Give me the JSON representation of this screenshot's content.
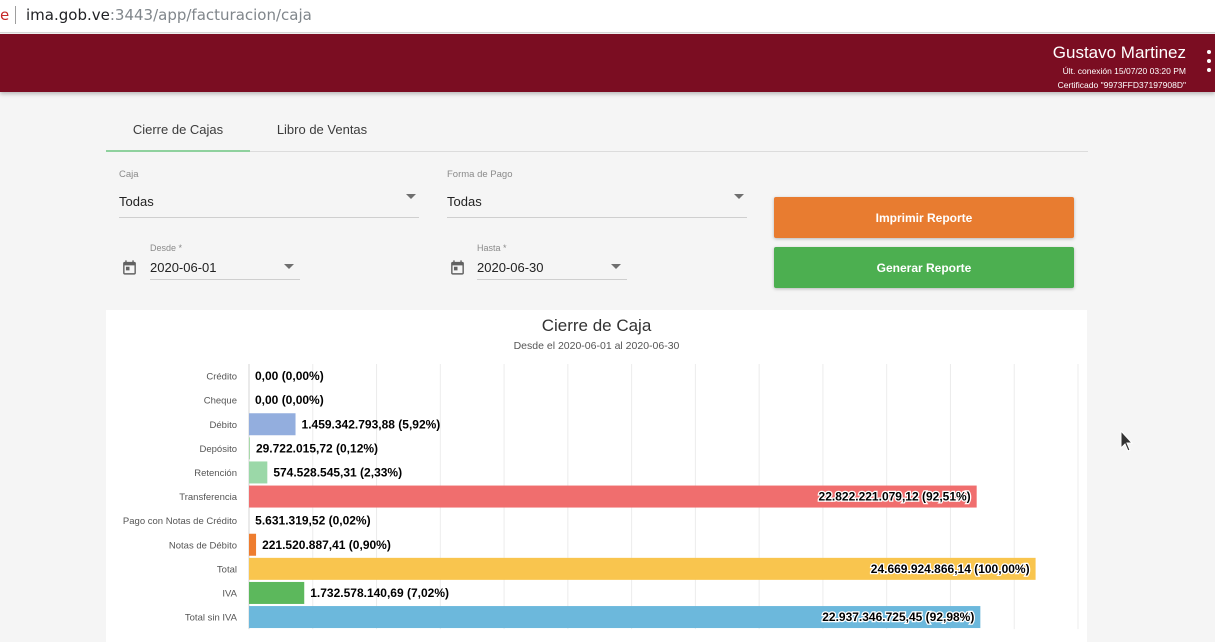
{
  "browser": {
    "url_fragment": "e",
    "url_host": "ima.gob.ve",
    "url_path": ":3443/app/facturacion/caja"
  },
  "header": {
    "user_name": "Gustavo Martinez",
    "last_login": "Últ. conexión 15/07/20 03:20 PM",
    "certificate": "Certificado \"9973FFD37197908D\"",
    "menu_icon": "more-vert-icon",
    "color": "#7b0d22"
  },
  "tabs": [
    {
      "label": "Cierre de Cajas",
      "active": true
    },
    {
      "label": "Libro de Ventas",
      "active": false
    }
  ],
  "filters": {
    "caja": {
      "label": "Caja",
      "value": "Todas"
    },
    "forma_pago": {
      "label": "Forma de Pago",
      "value": "Todas"
    },
    "desde": {
      "label": "Desde *",
      "value": "2020-06-01",
      "icon": "calendar-icon"
    },
    "hasta": {
      "label": "Hasta *",
      "value": "2020-06-30",
      "icon": "calendar-icon"
    }
  },
  "buttons": {
    "print_label": "Imprimir Reporte",
    "print_color": "#e87c30",
    "generate_label": "Generar Reporte",
    "generate_color": "#4caf50"
  },
  "chart_data": {
    "type": "bar",
    "orientation": "horizontal",
    "title": "Cierre de Caja",
    "subtitle": "Desde el 2020-06-01 al 2020-06-30",
    "grid": true,
    "categories": [
      "Crédito",
      "Cheque",
      "Débito",
      "Depósito",
      "Retención",
      "Transferencia",
      "Pago con Notas de Crédito",
      "Notas de Débito",
      "Total",
      "IVA",
      "Total sin IVA"
    ],
    "values": [
      0,
      0,
      1459342793.88,
      29722015.72,
      574528545.31,
      22822221079.12,
      5631319.52,
      221520887.41,
      24669924866.14,
      1732578140.69,
      22937346725.45
    ],
    "labels": [
      "0,00 (0,00%)",
      "0,00 (0,00%)",
      "1.459.342.793,88 (5,92%)",
      "29.722.015,72 (0,12%)",
      "574.528.545,31 (2,33%)",
      "22.822.221.079,12 (92,51%)",
      "5.631.319,52 (0,02%)",
      "221.520.887,41 (0,90%)",
      "24.669.924.866,14 (100,00%)",
      "1.732.578.140,69 (7,02%)",
      "22.937.346.725,45 (92,98%)"
    ],
    "colors": [
      "#9e9e9e",
      "#9e9e9e",
      "#93aede",
      "#a3d9a5",
      "#9bd8a8",
      "#f06e6e",
      "#9e9e9e",
      "#ee7d2f",
      "#f9c54e",
      "#5cb85c",
      "#6cb8dc"
    ],
    "xlim": [
      0,
      26000000000
    ]
  }
}
